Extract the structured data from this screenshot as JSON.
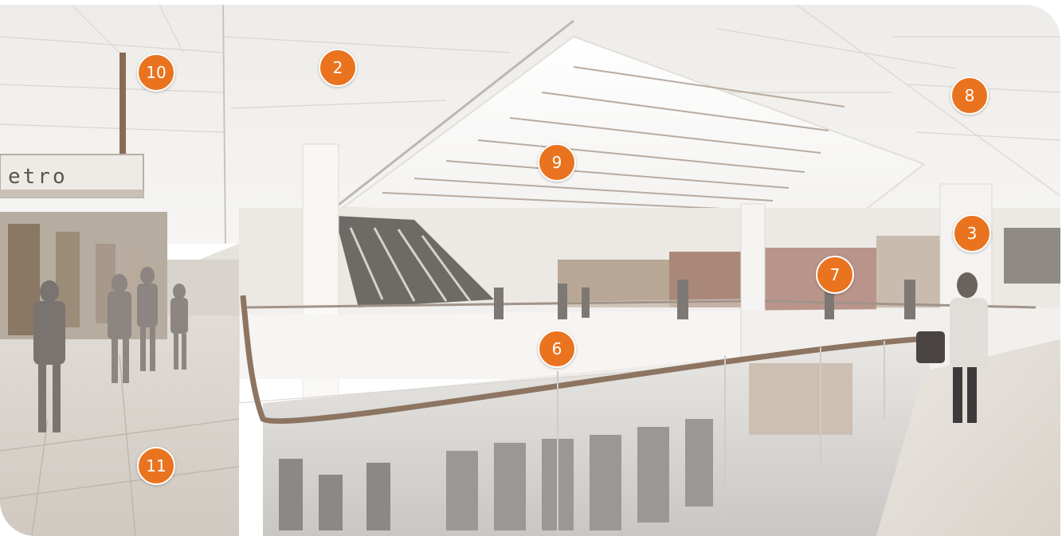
{
  "scene": {
    "sign_text": "etro",
    "accent_color": "#e9731f"
  },
  "markers": [
    {
      "id": "marker-2",
      "label": "2"
    },
    {
      "id": "marker-3",
      "label": "3"
    },
    {
      "id": "marker-6",
      "label": "6"
    },
    {
      "id": "marker-7",
      "label": "7"
    },
    {
      "id": "marker-8",
      "label": "8"
    },
    {
      "id": "marker-9",
      "label": "9"
    },
    {
      "id": "marker-10",
      "label": "10"
    },
    {
      "id": "marker-11",
      "label": "11"
    }
  ]
}
